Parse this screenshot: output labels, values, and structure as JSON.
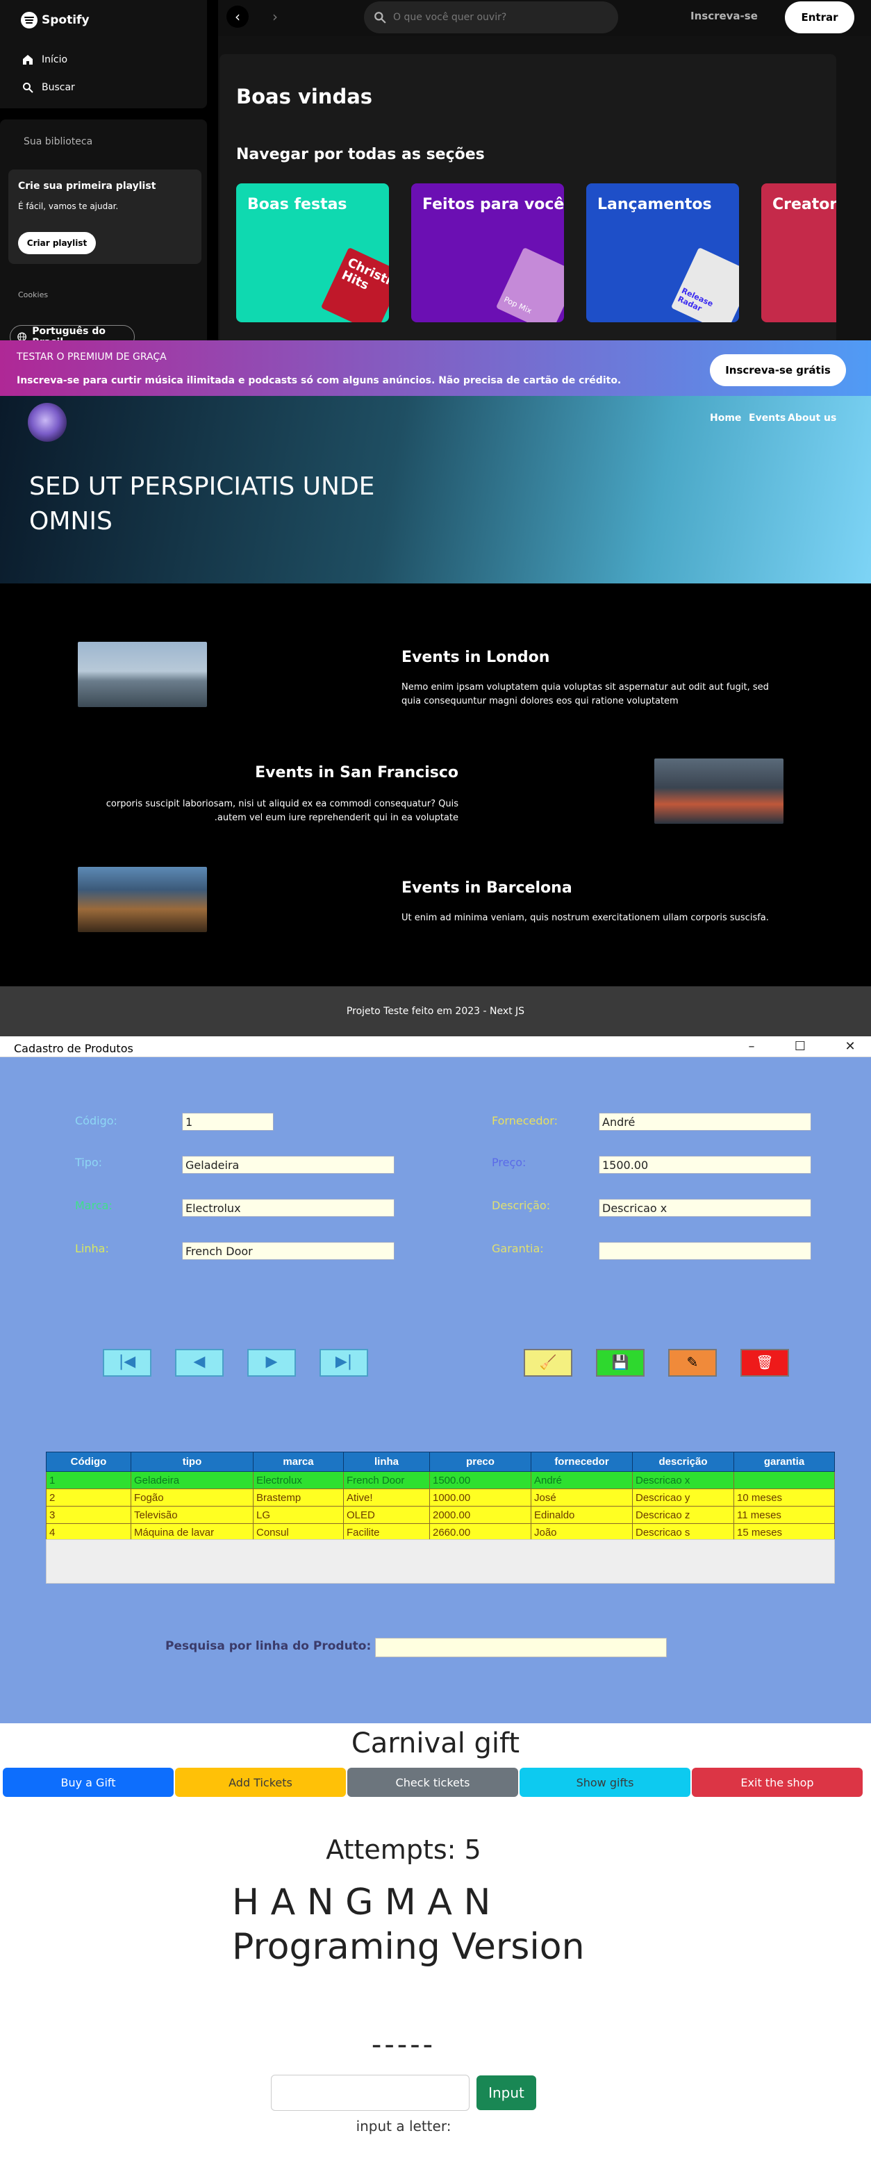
{
  "spotify": {
    "logo": "Spotify",
    "nav": [
      {
        "label": "Início",
        "icon": "home-icon"
      },
      {
        "label": "Buscar",
        "icon": "search-icon"
      }
    ],
    "library_title": "Sua biblioteca",
    "playlist_card": {
      "title": "Crie sua primeira playlist",
      "subtitle": "É fácil, vamos te ajudar.",
      "button": "Criar playlist"
    },
    "cookies": "Cookies",
    "language": "Português do Brasil",
    "search_placeholder": "O que você quer ouvir?",
    "signup": "Inscreva-se",
    "login": "Entrar",
    "welcome": "Boas vindas",
    "browse_title": "Navegar por todas as seções",
    "tiles": [
      {
        "label": "Boas festas",
        "color": "#0fd9b0",
        "art_color": "#c0182a"
      },
      {
        "label": "Feitos para você",
        "color": "#6b0fb3",
        "art_color": "#c58ad8"
      },
      {
        "label": "Lançamentos",
        "color": "#1e4fc8",
        "art_color": "#e8e8e8"
      },
      {
        "label": "Creators",
        "color": "#c52a4a",
        "art_color": "#c52a4a"
      }
    ],
    "art_texts": [
      "Christmas Hits",
      "Pop Mix",
      "Release Radar"
    ],
    "banner": {
      "title": "TESTAR O PREMIUM DE GRAÇA",
      "text": "Inscreva-se para curtir música ilimitada e podcasts só com alguns anúncios. Não precisa de cartão de crédito.",
      "button": "Inscreva-se grátis"
    }
  },
  "events": {
    "nav": [
      "Home",
      "Events",
      "About us"
    ],
    "hero_title": "SED UT PERSPICIATIS UNDE OMNIS",
    "items": [
      {
        "title": "Events in London",
        "text": "Nemo enim ipsam voluptatem quia voluptas sit aspernatur aut odit aut fugit, sed quia consequuntur magni dolores eos qui ratione voluptatem"
      },
      {
        "title": "Events in San Francisco",
        "text": "corporis suscipit laboriosam, nisi ut aliquid ex ea commodi consequatur? Quis .autem vel eum iure reprehenderit qui in ea voluptate"
      },
      {
        "title": "Events in Barcelona",
        "text": "Ut enim ad minima veniam, quis nostrum exercitationem ullam corporis suscisfa."
      }
    ],
    "footer": "Projeto Teste feito em 2023 - Next JS"
  },
  "cadastro": {
    "window_title": "Cadastro de Produtos",
    "fields": {
      "codigo": {
        "label": "Código:",
        "value": "1",
        "color": "#8ed7f4"
      },
      "tipo": {
        "label": "Tipo:",
        "value": "Geladeira",
        "color": "#8ed7f4"
      },
      "marca": {
        "label": "Marca:",
        "value": "Electrolux",
        "color": "#3fe08a"
      },
      "linha": {
        "label": "Linha:",
        "value": "French Door",
        "color": "#d8e860"
      },
      "fornecedor": {
        "label": "Fornecedor:",
        "value": "André",
        "color": "#e8e060"
      },
      "preco": {
        "label": "Preço:",
        "value": "1500.00",
        "color": "#5a6ae8"
      },
      "descricao": {
        "label": "Descrição:",
        "value": "Descricao x",
        "color": "#e0e070"
      },
      "garantia": {
        "label": "Garantia:",
        "value": "",
        "color": "#e0e070"
      }
    },
    "table": {
      "headers": [
        "Código",
        "tipo",
        "marca",
        "linha",
        "preco",
        "fornecedor",
        "descrição",
        "garantia"
      ],
      "rows": [
        [
          "1",
          "Geladeira",
          "Electrolux",
          "French Door",
          "1500.00",
          "André",
          "Descricao x",
          ""
        ],
        [
          "2",
          "Fogão",
          "Brastemp",
          "Ative!",
          "1000.00",
          "José",
          "Descricao y",
          "10 meses"
        ],
        [
          "3",
          "Televisão",
          "LG",
          "OLED",
          "2000.00",
          "Edinaldo",
          "Descricao z",
          "11 meses"
        ],
        [
          "4",
          "Máquina de lavar",
          "Consul",
          "Facilite",
          "2660.00",
          "João",
          "Descricao s",
          "15 meses"
        ]
      ]
    },
    "search_label": "Pesquisa por linha do Produto:"
  },
  "carnival": {
    "title": "Carnival gift",
    "buttons": [
      {
        "label": "Buy a Gift",
        "color": "#0d6efd",
        "text_color": "#ffffff"
      },
      {
        "label": "Add Tickets",
        "color": "#ffc107",
        "text_color": "#3a3a3a"
      },
      {
        "label": "Check tickets",
        "color": "#6c757d",
        "text_color": "#ffffff"
      },
      {
        "label": "Show gifts",
        "color": "#0dcaf0",
        "text_color": "#3a3a3a"
      },
      {
        "label": "Exit the shop",
        "color": "#dc3545",
        "text_color": "#ffffff"
      }
    ],
    "attempts": "Attempts: 5",
    "hangman_line1": "H A N G M A N",
    "hangman_line2": "Programing Version",
    "word": "-----",
    "input_button": "Input",
    "hint": "input a letter:"
  }
}
